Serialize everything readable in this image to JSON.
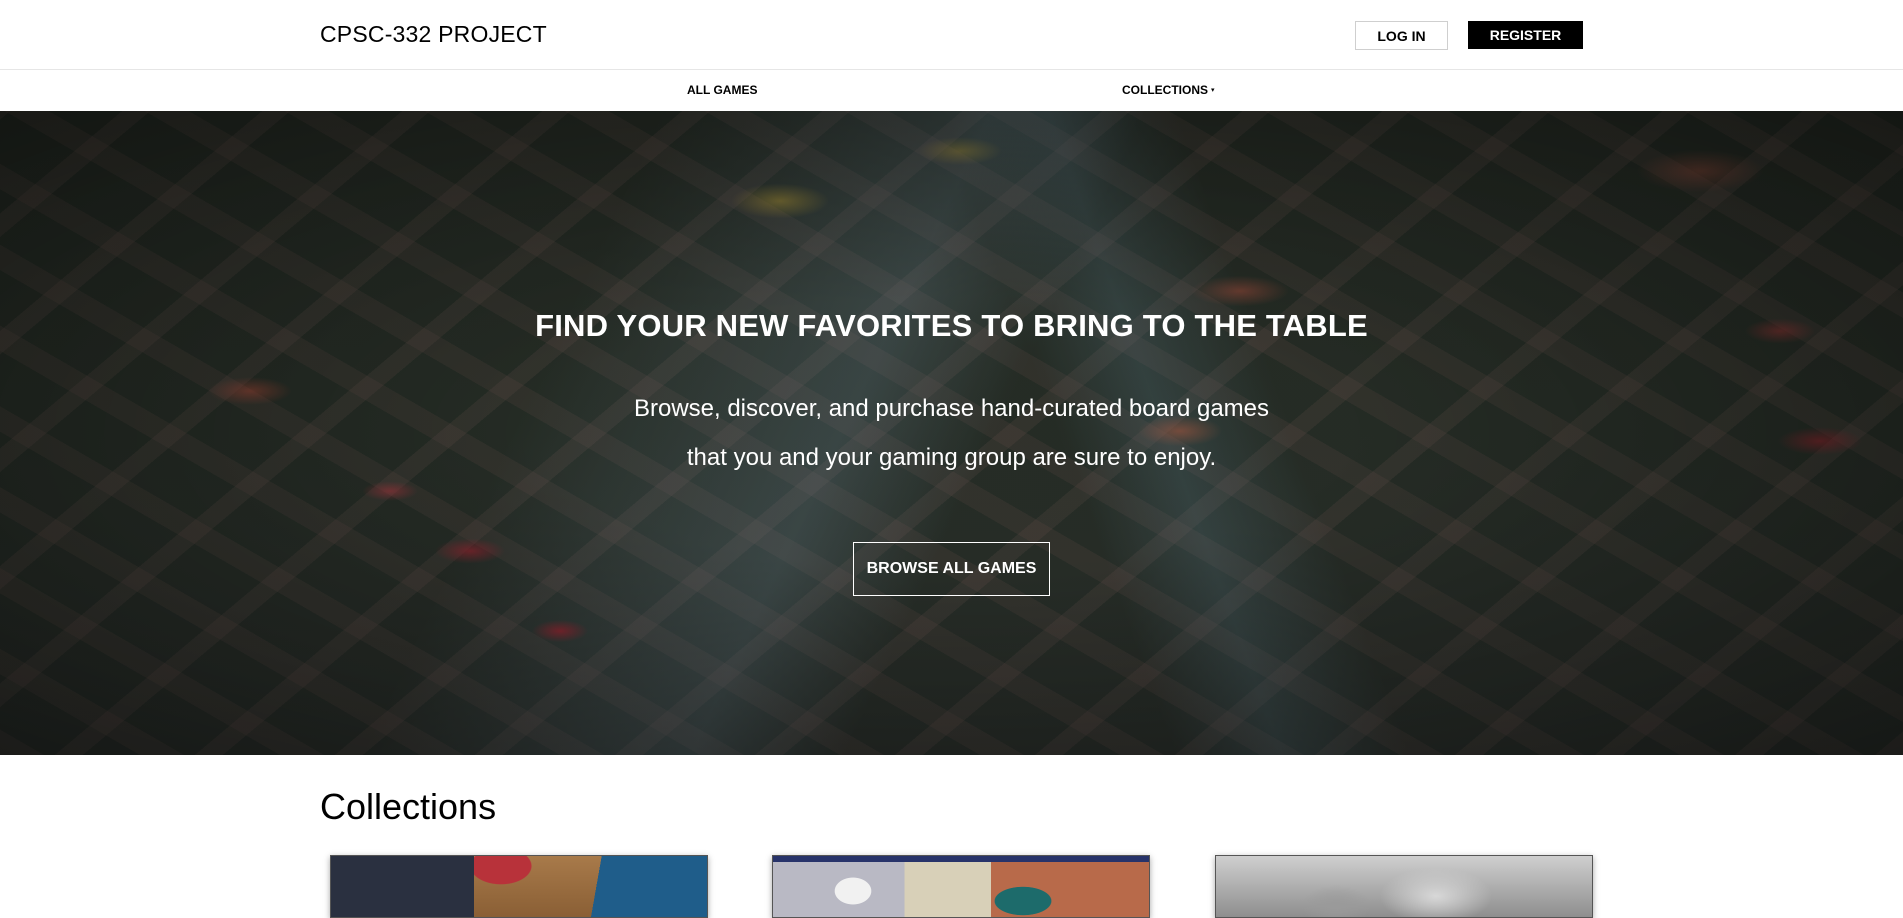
{
  "header": {
    "brand": "CPSC-332 PROJECT",
    "login_label": "LOG IN",
    "register_label": "REGISTER"
  },
  "nav": {
    "items": [
      {
        "label": "ALL GAMES"
      },
      {
        "label": "COLLECTIONS",
        "has_dropdown": true,
        "caret": "▾"
      }
    ]
  },
  "hero": {
    "title": "FIND YOUR NEW FAVORITES TO BRING TO THE TABLE",
    "subtitle_line1": "Browse, discover, and purchase hand-curated board games",
    "subtitle_line2": "that you and your gaming group are sure to enjoy.",
    "cta_label": "BROWSE ALL GAMES"
  },
  "collections": {
    "title": "Collections",
    "cards": [
      {
        "image": "board-game-boxes-photo"
      },
      {
        "image": "dice-and-cards-game-photo"
      },
      {
        "image": "miniature-figures-photo"
      }
    ]
  },
  "colors": {
    "accent": "#000000",
    "background": "#ffffff",
    "hero_text": "#ffffff"
  }
}
